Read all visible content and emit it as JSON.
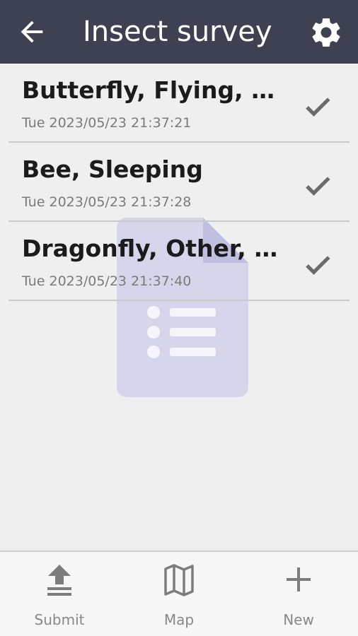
{
  "header": {
    "title": "Insect survey"
  },
  "records": [
    {
      "name": "Butterfly, Flying, Eati...",
      "timestamp": "Tue 2023/05/23 21:37:21"
    },
    {
      "name": "Bee, Sleeping",
      "timestamp": "Tue 2023/05/23 21:37:28"
    },
    {
      "name": "Dragonfly, Other, Wal...",
      "timestamp": "Tue 2023/05/23 21:37:40"
    }
  ],
  "bottom_nav": [
    {
      "label": "Submit",
      "icon": "upload-icon"
    },
    {
      "label": "Map",
      "icon": "map-icon"
    },
    {
      "label": "New",
      "icon": "plus-icon"
    }
  ],
  "colors": {
    "header_bg": "#3d4152",
    "body_bg": "#efefef",
    "check": "#6b6b6b",
    "watermark": "#d2d0ea"
  }
}
